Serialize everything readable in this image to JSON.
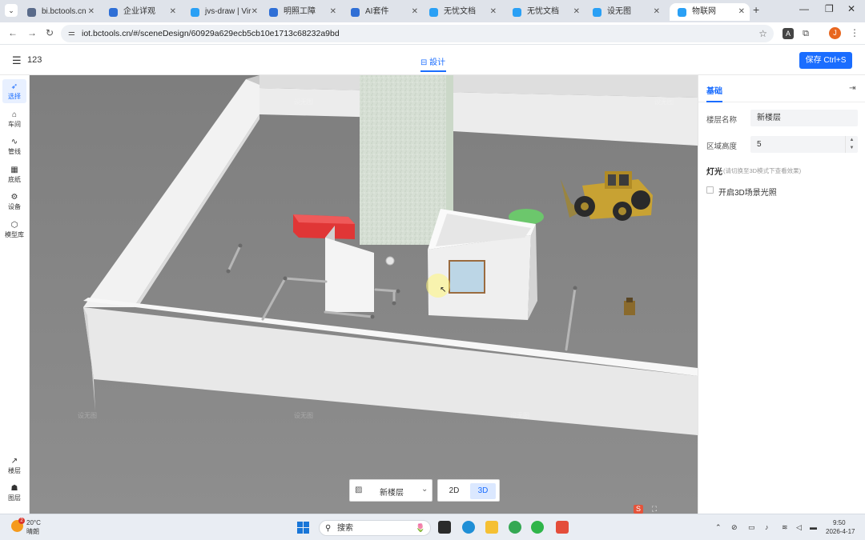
{
  "browser": {
    "tabs": [
      {
        "label": "bi.bctools.cn",
        "color": "#5a6b8a",
        "active": false
      },
      {
        "label": "企业详观",
        "color": "#2f6fd6",
        "active": false
      },
      {
        "label": "jvs-draw | Vir",
        "color": "#2aa0f5",
        "active": false
      },
      {
        "label": "明照工障",
        "color": "#2f6fd6",
        "active": false
      },
      {
        "label": "AI套件",
        "color": "#2f6fd6",
        "active": false
      },
      {
        "label": "无忧文档",
        "color": "#2aa0f5",
        "active": false
      },
      {
        "label": "无忧文档",
        "color": "#2aa0f5",
        "active": false
      },
      {
        "label": "设无图",
        "color": "#2aa0f5",
        "active": false
      },
      {
        "label": "物联网",
        "color": "#2aa0f5",
        "active": true
      }
    ],
    "url": "iot.bctools.cn/#/sceneDesign/60929a629ecb5cb10e1713c68232a9bd",
    "profile_initial": "J"
  },
  "header": {
    "project_name": "123",
    "design_tab": "設计",
    "save_label": "保存 Ctrl+S"
  },
  "left_toolbar": {
    "items": [
      {
        "label": "选择",
        "icon": "cursor-icon",
        "glyph": "➶"
      },
      {
        "label": "车间",
        "icon": "workshop-icon",
        "glyph": "⌂"
      },
      {
        "label": "管线",
        "icon": "pipeline-icon",
        "glyph": "∿"
      },
      {
        "label": "底纸",
        "icon": "floorplan-icon",
        "glyph": "▦"
      },
      {
        "label": "设备",
        "icon": "device-icon",
        "glyph": "⚙"
      },
      {
        "label": "模型库",
        "icon": "model-library-icon",
        "glyph": "⬡"
      }
    ],
    "bottom_items": [
      {
        "label": "楼层",
        "icon": "chart-icon",
        "glyph": "↗"
      },
      {
        "label": "图层",
        "icon": "layers-icon",
        "glyph": "☗"
      }
    ]
  },
  "viewport": {
    "floor_name": "新楼层",
    "mode_2d": "2D",
    "mode_3d": "3D",
    "active_mode": "3D",
    "background": "#8b8b8b"
  },
  "right_panel": {
    "tab": "基础",
    "floor_name_label": "楼层名称",
    "floor_name_value": "新楼层",
    "area_height_label": "区域高度",
    "area_height_value": "5",
    "light_section": "灯光",
    "light_note": "(请切换至3D模式下查看效果)",
    "light_checkbox_label": "开启3D场景光照"
  },
  "taskbar": {
    "weather_temp": "20°C",
    "weather_desc": "晴朗",
    "weather_badge": "2",
    "search_placeholder": "搜索",
    "time": "9:50",
    "date": "2026-4-17"
  },
  "colors": {
    "accent": "#1a6dff",
    "wall": "#ebebeb",
    "floor": "#8b8b8b"
  }
}
